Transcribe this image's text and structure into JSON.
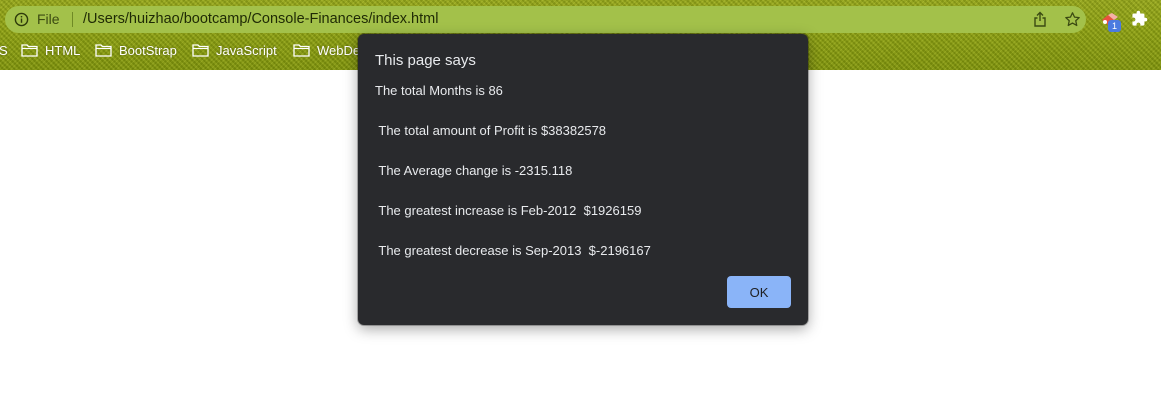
{
  "browser": {
    "omnibox": {
      "scheme_label": "File",
      "url": "/Users/huizhao/bootcamp/Console-Finances/index.html",
      "icons": [
        "info-icon",
        "share-icon",
        "star-icon"
      ]
    },
    "extensions": {
      "badge_count": "1",
      "icons": [
        "extension-icon",
        "puzzle-icon"
      ]
    },
    "bookmarks": [
      {
        "label": "S",
        "icon": ""
      },
      {
        "label": "HTML",
        "icon": "folder-icon"
      },
      {
        "label": "BootStrap",
        "icon": "folder-icon"
      },
      {
        "label": "JavaScript",
        "icon": "folder-icon"
      },
      {
        "label": "WebDe",
        "icon": "folder-icon"
      }
    ]
  },
  "dialog": {
    "title": "This page says",
    "lines": [
      "The total Months is 86",
      " The total amount of Profit is $38382578",
      " The Average change is -2315.118",
      " The greatest increase is Feb-2012  $1926159",
      " The greatest decrease is Sep-2013  $-2196167"
    ],
    "ok_label": "OK",
    "colors": {
      "background": "#292a2d",
      "text": "#e8eaed",
      "button": "#8ab4f8"
    }
  }
}
